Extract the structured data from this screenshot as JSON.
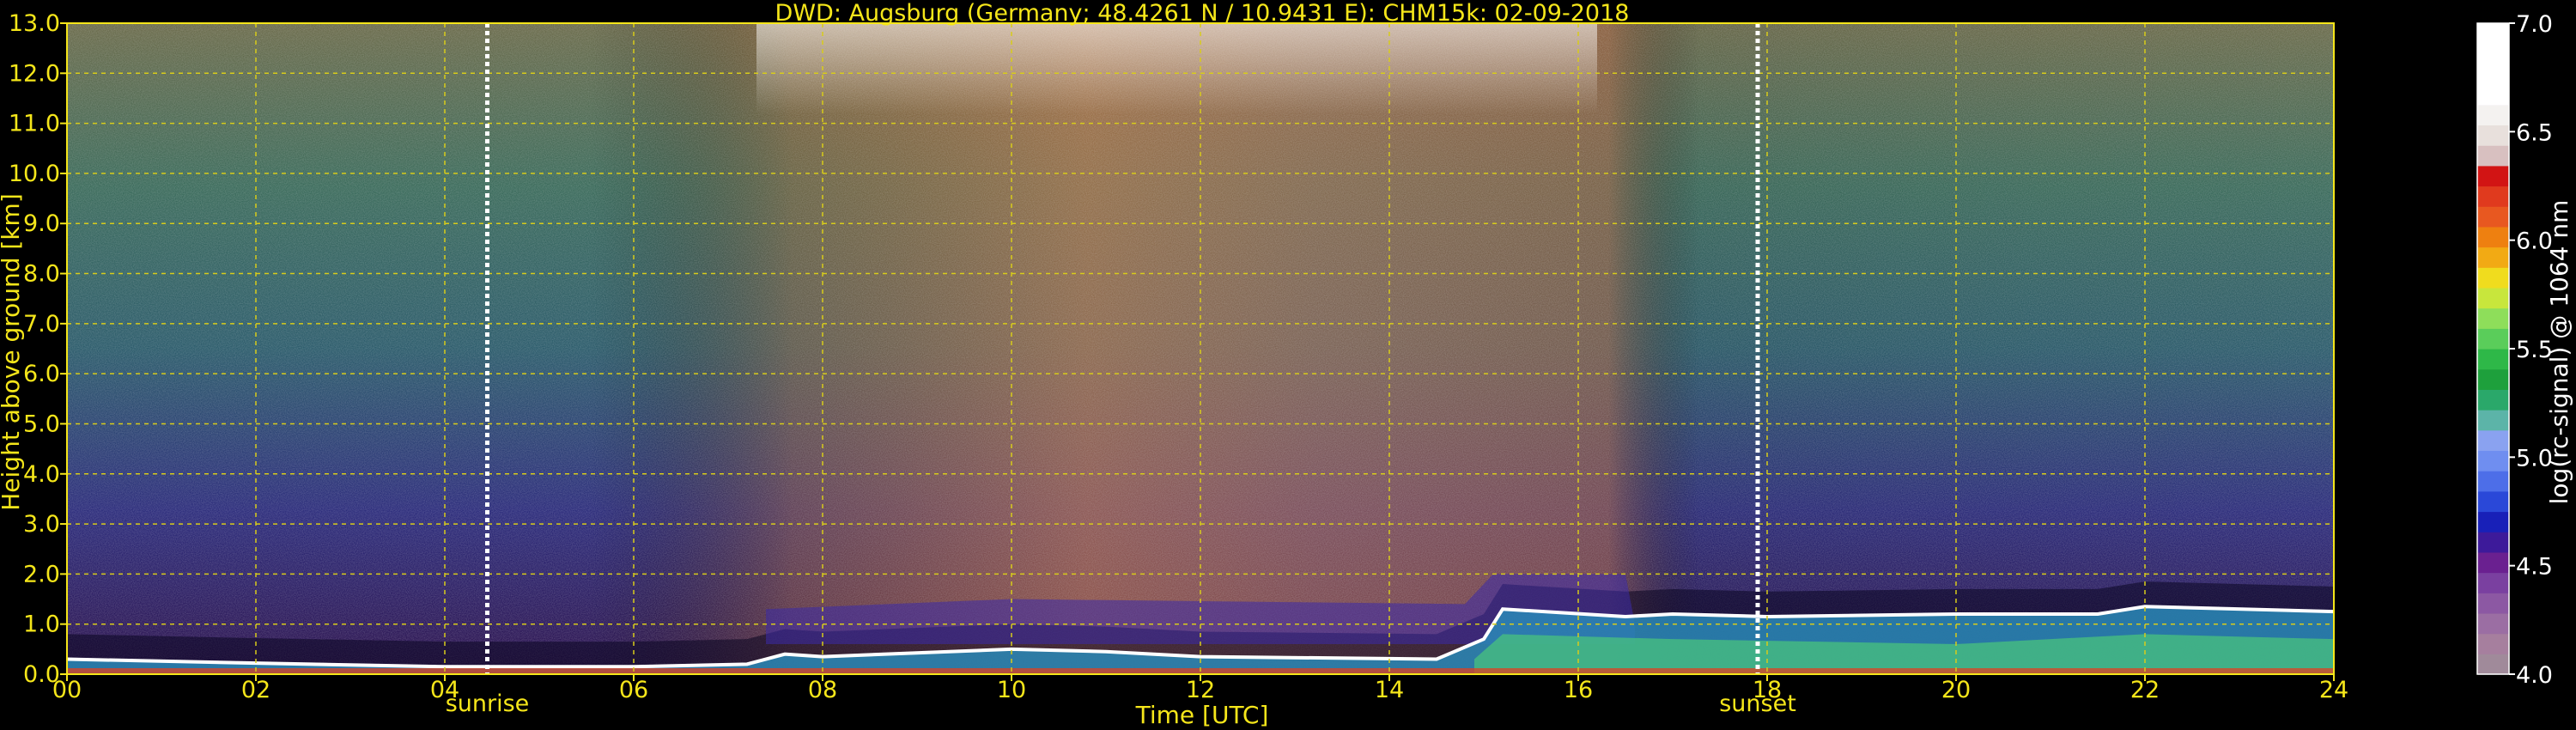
{
  "chart_data": {
    "type": "heatmap",
    "title": "DWD: Augsburg (Germany; 48.4261 N / 10.9431 E):    CHM15k: 02-09-2018",
    "xlabel": "Time [UTC]",
    "ylabel": "Height above ground [km]",
    "x_ticks": [
      "00",
      "02",
      "04",
      "06",
      "08",
      "10",
      "12",
      "14",
      "16",
      "18",
      "20",
      "22",
      "24"
    ],
    "y_ticks": [
      "0.0",
      "1.0",
      "2.0",
      "3.0",
      "4.0",
      "5.0",
      "6.0",
      "7.0",
      "8.0",
      "9.0",
      "10.0",
      "11.0",
      "12.0",
      "13.0"
    ],
    "xlim": [
      0,
      24
    ],
    "ylim": [
      0,
      13
    ],
    "grid": true,
    "colorbar": {
      "label": "log(rc-signal) @ 1064 nm",
      "range": [
        4.0,
        7.0
      ],
      "ticks": [
        "4.0",
        "4.5",
        "5.0",
        "5.5",
        "6.0",
        "6.5",
        "7.0"
      ],
      "colors": [
        "#a08a9a",
        "#a67f9e",
        "#9b6ea3",
        "#8c58a3",
        "#7a40a0",
        "#6a2090",
        "#3d1a9a",
        "#1820b8",
        "#2a48d8",
        "#4d6ee8",
        "#6f8ef0",
        "#8aa2f0",
        "#5cb4a8",
        "#2aa86a",
        "#1ea03c",
        "#2eb848",
        "#5acd5a",
        "#8ede5a",
        "#c8e63c",
        "#f0dc1e",
        "#f2aa14",
        "#ee8010",
        "#e85820",
        "#e03a1e",
        "#d21414",
        "#d8c0c0",
        "#e8e0dc",
        "#f4f2f0",
        "#ffffff",
        "#ffffff",
        "#ffffff",
        "#ffffff"
      ]
    },
    "markers": [
      {
        "label": "sunrise",
        "x": 4.45
      },
      {
        "label": "sunset",
        "x": 17.9
      }
    ],
    "background_profile": {
      "columns": [
        {
          "x": 0,
          "color": "#3a1a6a",
          "upper": "#2a5a6a"
        },
        {
          "x": 4,
          "color": "#2a1a5a",
          "upper": "#3a6a6a"
        },
        {
          "x": 6,
          "color": "#4a3a6a",
          "upper": "#6a7a4a"
        },
        {
          "x": 8,
          "color": "#6a3a4a",
          "upper": "#9a6a5a"
        },
        {
          "x": 10,
          "color": "#7a4a3a",
          "upper": "#a08070"
        },
        {
          "x": 12,
          "color": "#6a3a3a",
          "upper": "#9a6a5a"
        },
        {
          "x": 14,
          "color": "#6a3a3a",
          "upper": "#9a6a5a"
        },
        {
          "x": 16,
          "color": "#5a2a3a",
          "upper": "#8a5a4a"
        },
        {
          "x": 17.5,
          "color": "#2a2a6a",
          "upper": "#3a6a6a"
        },
        {
          "x": 20,
          "color": "#2a1a5a",
          "upper": "#2a5a6a"
        },
        {
          "x": 24,
          "color": "#2a1a5a",
          "upper": "#2a5a6a"
        }
      ]
    },
    "boundary_layer": [
      {
        "x": 0,
        "y": 0.3
      },
      {
        "x": 2,
        "y": 0.22
      },
      {
        "x": 4,
        "y": 0.15
      },
      {
        "x": 6,
        "y": 0.15
      },
      {
        "x": 7.2,
        "y": 0.2
      },
      {
        "x": 7.6,
        "y": 0.4
      },
      {
        "x": 8,
        "y": 0.35
      },
      {
        "x": 10,
        "y": 0.5
      },
      {
        "x": 11,
        "y": 0.45
      },
      {
        "x": 12,
        "y": 0.35
      },
      {
        "x": 14.5,
        "y": 0.3
      },
      {
        "x": 15,
        "y": 0.7
      },
      {
        "x": 15.2,
        "y": 1.3
      },
      {
        "x": 16.5,
        "y": 1.15
      },
      {
        "x": 17,
        "y": 1.2
      },
      {
        "x": 18,
        "y": 1.15
      },
      {
        "x": 20,
        "y": 1.2
      },
      {
        "x": 21.5,
        "y": 1.2
      },
      {
        "x": 22,
        "y": 1.35
      },
      {
        "x": 24,
        "y": 1.25
      }
    ]
  }
}
